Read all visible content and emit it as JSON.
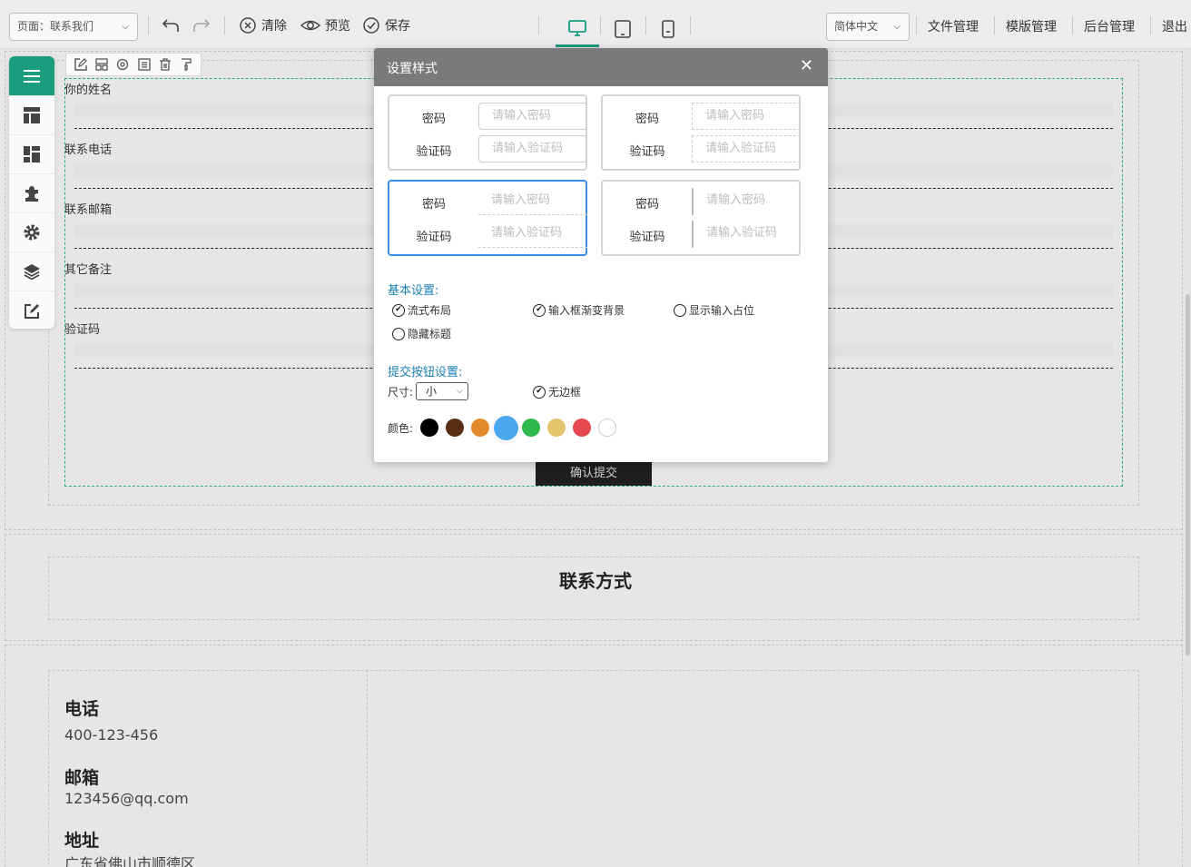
{
  "topbar": {
    "page_select": "页面：联系我们",
    "clear_label": "清除",
    "preview_label": "预览",
    "save_label": "保存",
    "language": "简体中文",
    "links": [
      "文件管理",
      "模版管理",
      "后台管理",
      "退出"
    ],
    "accent_color": "#1a9c7f"
  },
  "left_toolbar": {
    "icons": [
      "menu-icon",
      "layout-icon",
      "widgets-icon",
      "plugin-icon",
      "settings-icon",
      "layers-icon",
      "edit-icon"
    ]
  },
  "mini_toolbar": {
    "icons": [
      "edit-icon",
      "grid-icon",
      "target-icon",
      "list-icon",
      "delete-icon",
      "format-painter-icon"
    ]
  },
  "form": {
    "fields": [
      "你的姓名",
      "联系电话",
      "联系邮箱",
      "其它备注",
      "验证码"
    ],
    "submit_label": "确认提交"
  },
  "contact": {
    "title": "联系方式",
    "phone_heading": "电话",
    "phone": "400-123-456",
    "email_heading": "邮箱",
    "email": "123456@qq.com",
    "address_heading": "地址",
    "address": "广东省佛山市顺德区"
  },
  "dialog": {
    "title": "设置样式",
    "password_label": "密码",
    "password_placeholder": "请输入密码",
    "captcha_label": "验证码",
    "captcha_placeholder": "请输入验证码",
    "basic_settings": "基本设置:",
    "options": {
      "flow_layout": "流式布局",
      "gradient_bg": "输入框渐变背景",
      "show_placeholder": "显示输入占位",
      "hide_title": "隐藏标题"
    },
    "submit_settings": "提交按钮设置:",
    "size_label": "尺寸:",
    "size_value": "小",
    "no_border": "无边框",
    "color_label": "颜色:",
    "colors": [
      "#000000",
      "#5a2e14",
      "#e08a2c",
      "#4aa8ef",
      "#2db84d",
      "#e3c56d",
      "#e5484d",
      "#ffffff"
    ],
    "selected_color": "#4aa8ef"
  }
}
